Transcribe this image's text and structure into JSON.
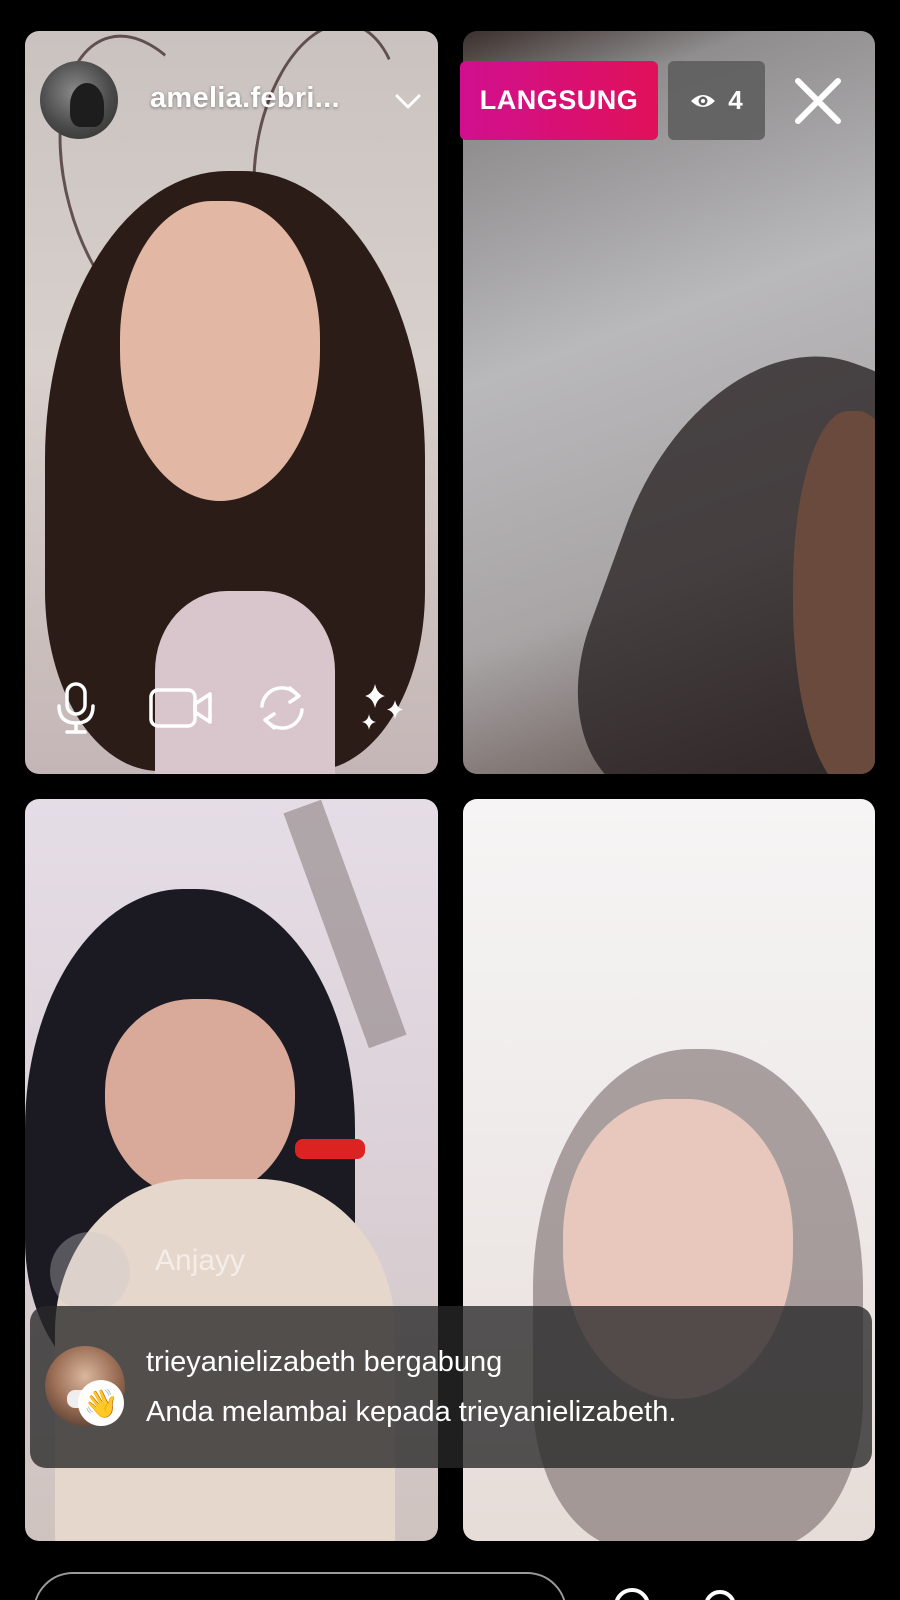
{
  "header": {
    "host_username": "amelia.febri...",
    "live_label": "LANGSUNG",
    "viewer_count": "4"
  },
  "guests": [
    {
      "name": "Anjayy"
    }
  ],
  "toast": {
    "join_text": "trieyanielizabeth bergabung",
    "wave_text": "Anda melambai kepada trieyanielizabeth."
  },
  "icons": {
    "eye": "eye-icon",
    "close": "close-icon",
    "mic": "microphone-icon",
    "camera": "video-camera-icon",
    "flip": "flip-camera-icon",
    "effects": "sparkles-icon",
    "wave": "waving-hand-icon"
  },
  "colors": {
    "live_gradient_start": "#d10f8f",
    "live_gradient_end": "#e01159",
    "viewer_badge_bg": "#5f5f5f",
    "background": "#000000"
  }
}
